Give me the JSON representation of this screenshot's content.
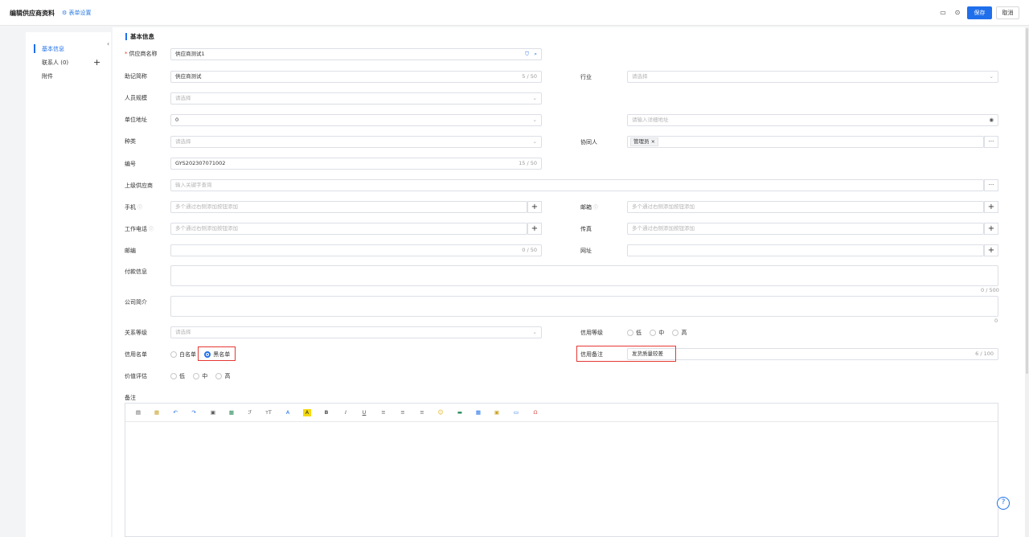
{
  "header": {
    "title": "编辑供应商资料",
    "form_settings": "表单设置",
    "save": "保存",
    "cancel": "取消"
  },
  "sidebar": {
    "items": [
      {
        "label": "基本信息",
        "active": true
      },
      {
        "label": "联系人 (0)",
        "active": false
      },
      {
        "label": "附件",
        "active": false
      }
    ]
  },
  "section": {
    "title": "基本信息"
  },
  "fields": {
    "supplier_name": {
      "label": "供应商名称",
      "value": "供应商测试1"
    },
    "mnemonic": {
      "label": "助记简称",
      "value": "供应商测试",
      "count": "5 / 50"
    },
    "industry": {
      "label": "行业",
      "placeholder": "请选择"
    },
    "staff_size": {
      "label": "人员规模",
      "placeholder": "请选择"
    },
    "address": {
      "label": "单位地址",
      "value": "0",
      "detail_placeholder": "请输入详细地址"
    },
    "category": {
      "label": "种类",
      "placeholder": "请选择"
    },
    "collaborator": {
      "label": "协同人",
      "tag": "管理员"
    },
    "code": {
      "label": "编号",
      "value": "GYS202307071002",
      "count": "15 / 50"
    },
    "parent": {
      "label": "上级供应商",
      "placeholder": "输入关键字查询"
    },
    "mobile": {
      "label": "手机",
      "placeholder": "多个通过右侧添加按钮添加"
    },
    "email": {
      "label": "邮箱",
      "placeholder": "多个通过右侧添加按钮添加"
    },
    "work_phone": {
      "label": "工作电话",
      "placeholder": "多个通过右侧添加按钮添加"
    },
    "fax": {
      "label": "传真",
      "placeholder": "多个通过右侧添加按钮添加"
    },
    "postcode": {
      "label": "邮编",
      "count": "0 / 50"
    },
    "website": {
      "label": "网址"
    },
    "payment": {
      "label": "付款信息",
      "count": "0 / 500"
    },
    "intro": {
      "label": "公司简介",
      "count": "0"
    },
    "relation_level": {
      "label": "关系等级",
      "placeholder": "请选择"
    },
    "credit_level": {
      "label": "信用等级",
      "options": [
        "低",
        "中",
        "高"
      ]
    },
    "credit_list": {
      "label": "信用名单",
      "options": [
        "白名单",
        "黑名单"
      ],
      "selected": "黑名单"
    },
    "credit_note": {
      "label": "信用备注",
      "value": "发货质量较差",
      "count": "6 / 100"
    },
    "value_eval": {
      "label": "价值评估",
      "options": [
        "低",
        "中",
        "高"
      ]
    },
    "remark": {
      "label": "备注"
    }
  },
  "editor_tools": [
    "paste-icon",
    "paste-word-icon",
    "undo-icon",
    "redo-icon",
    "format-painter-icon",
    "clear-format-icon",
    "font-family-icon",
    "font-size-icon",
    "font-color-icon",
    "highlight-icon",
    "bold-icon",
    "italic-icon",
    "underline-icon",
    "align-left-icon",
    "align-center-icon",
    "align-right-icon",
    "emoji-icon",
    "link-icon",
    "table-icon",
    "image-icon",
    "hr-icon",
    "special-char-icon"
  ],
  "colors": {
    "primary": "#1f6feb",
    "highlight_border": "#e53935"
  }
}
